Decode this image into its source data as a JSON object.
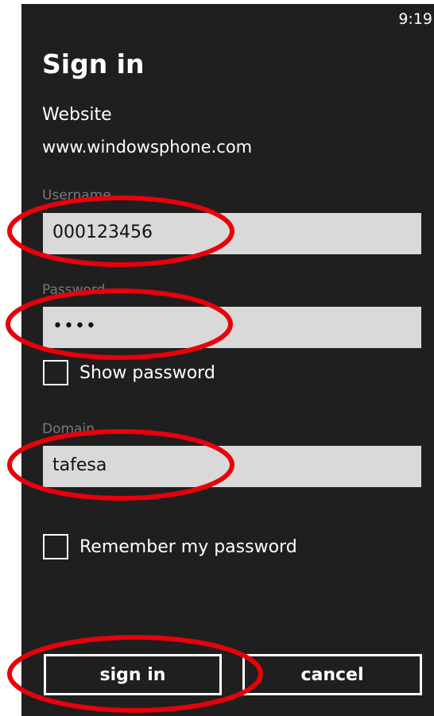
{
  "status_bar": {
    "time": "9:19"
  },
  "page": {
    "title": "Sign in"
  },
  "website": {
    "label": "Website",
    "value": "www.windowsphone.com"
  },
  "username": {
    "label": "Username",
    "value": "000123456"
  },
  "password": {
    "label": "Password",
    "value": "••••"
  },
  "show_password": {
    "label": "Show password",
    "checked": false
  },
  "domain": {
    "label": "Domain",
    "value": "tafesa"
  },
  "remember_password": {
    "label": "Remember my password",
    "checked": false
  },
  "buttons": {
    "sign_in": "sign in",
    "cancel": "cancel"
  },
  "colors": {
    "background": "#1f1f1f",
    "field": "#d9d9d9",
    "highlight": "#e8000b"
  }
}
